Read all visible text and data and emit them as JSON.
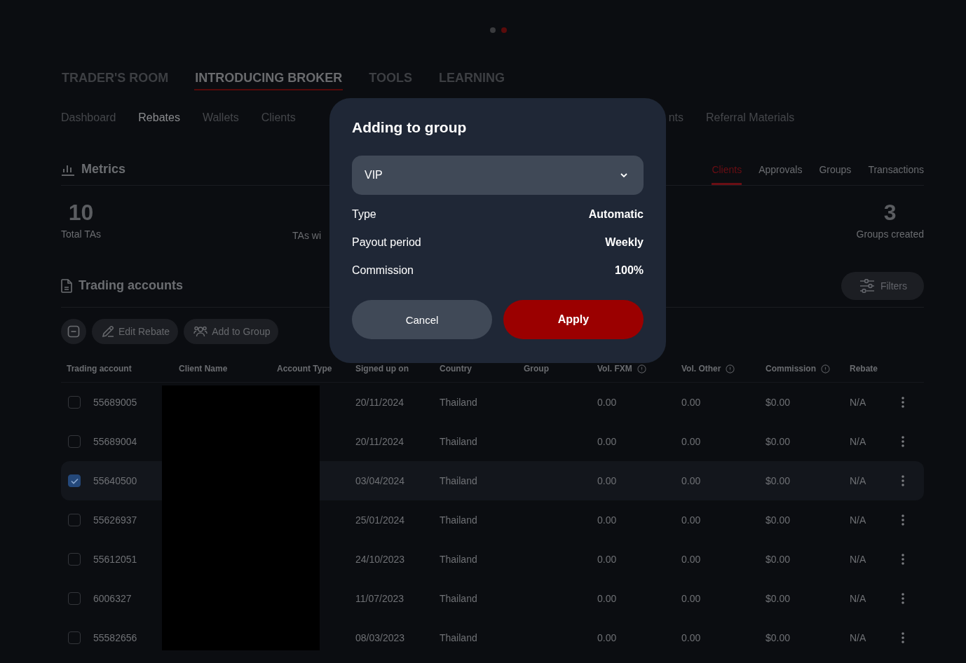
{
  "page_dots": [
    {
      "selected": false
    },
    {
      "selected": true
    }
  ],
  "main_nav": [
    {
      "label": "TRADER'S ROOM",
      "selected": false
    },
    {
      "label": "INTRODUCING BROKER",
      "selected": true
    },
    {
      "label": "TOOLS",
      "selected": false
    },
    {
      "label": "LEARNING",
      "selected": false
    }
  ],
  "sub_nav": [
    {
      "label": "Dashboard",
      "selected": false
    },
    {
      "label": "Rebates",
      "selected": true
    },
    {
      "label": "Wallets",
      "selected": false
    },
    {
      "label": "Clients",
      "selected": false
    },
    {
      "label": "nts",
      "selected": false
    },
    {
      "label": "Referral Materials",
      "selected": false
    }
  ],
  "metrics": {
    "title": "Metrics",
    "tabs": [
      {
        "label": "Clients",
        "selected": true
      },
      {
        "label": "Approvals",
        "selected": false
      },
      {
        "label": "Groups",
        "selected": false
      },
      {
        "label": "Transactions",
        "selected": false
      }
    ],
    "items": [
      {
        "value": "10",
        "label": "Total TAs"
      },
      {
        "label": "TAs wi"
      },
      {
        "value": "3",
        "label": "Groups created"
      }
    ]
  },
  "trading_accounts": {
    "title": "Trading accounts",
    "filters": "Filters",
    "actions": [
      "Edit Rebate",
      "Add to Group"
    ],
    "columns": [
      {
        "label": "Trading account",
        "info": false
      },
      {
        "label": "Client Name",
        "info": false
      },
      {
        "label": "Account Type",
        "info": false
      },
      {
        "label": "Signed up on",
        "info": false
      },
      {
        "label": "Country",
        "info": false
      },
      {
        "label": "Group",
        "info": false
      },
      {
        "label": "Vol. FXM",
        "info": true
      },
      {
        "label": "Vol. Other",
        "info": true
      },
      {
        "label": "Commission",
        "info": true
      },
      {
        "label": "Rebate",
        "info": false
      }
    ],
    "rows": [
      {
        "selected": false,
        "account": "55689005",
        "signed_up_on": "20/11/2024",
        "country": "Thailand",
        "vol_fxm": "0.00",
        "vol_other": "0.00",
        "commission": "$0.00",
        "rebate": "N/A"
      },
      {
        "selected": false,
        "account": "55689004",
        "signed_up_on": "20/11/2024",
        "country": "Thailand",
        "vol_fxm": "0.00",
        "vol_other": "0.00",
        "commission": "$0.00",
        "rebate": "N/A"
      },
      {
        "selected": true,
        "account": "55640500",
        "signed_up_on": "03/04/2024",
        "country": "Thailand",
        "vol_fxm": "0.00",
        "vol_other": "0.00",
        "commission": "$0.00",
        "rebate": "N/A"
      },
      {
        "selected": false,
        "account": "55626937",
        "signed_up_on": "25/01/2024",
        "country": "Thailand",
        "vol_fxm": "0.00",
        "vol_other": "0.00",
        "commission": "$0.00",
        "rebate": "N/A"
      },
      {
        "selected": false,
        "account": "55612051",
        "signed_up_on": "24/10/2023",
        "country": "Thailand",
        "vol_fxm": "0.00",
        "vol_other": "0.00",
        "commission": "$0.00",
        "rebate": "N/A"
      },
      {
        "selected": false,
        "account": "6006327",
        "signed_up_on": "11/07/2023",
        "country": "Thailand",
        "vol_fxm": "0.00",
        "vol_other": "0.00",
        "commission": "$0.00",
        "rebate": "N/A"
      },
      {
        "selected": false,
        "account": "55582656",
        "signed_up_on": "08/03/2023",
        "country": "Thailand",
        "vol_fxm": "0.00",
        "vol_other": "0.00",
        "commission": "$0.00",
        "rebate": "N/A"
      }
    ]
  },
  "dialog": {
    "title": "Adding to group",
    "group": "VIP",
    "details": [
      {
        "label": "Type",
        "value": "Automatic"
      },
      {
        "label": "Payout period",
        "value": "Weekly"
      },
      {
        "label": "Commission",
        "value": "100%"
      }
    ],
    "cancel": "Cancel",
    "apply": "Apply"
  }
}
